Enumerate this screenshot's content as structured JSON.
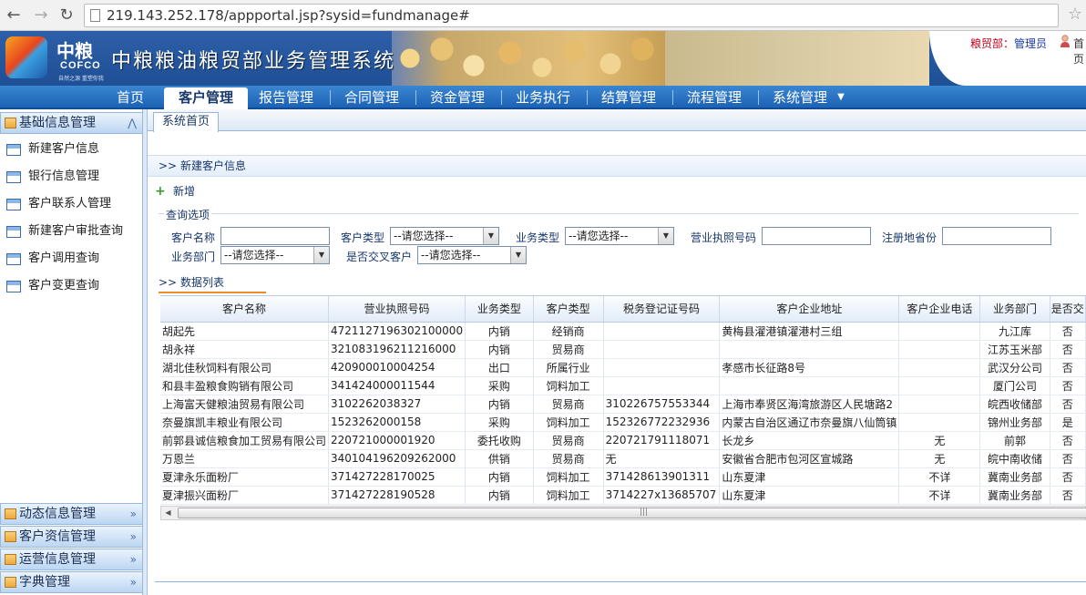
{
  "browser": {
    "url": "219.143.252.178/appportal.jsp?sysid=fundmanage#"
  },
  "header": {
    "logo_cn": "中粮",
    "logo_en": "COFCO",
    "logo_slogan": "自然之源 重塑你我",
    "title": "中粮粮油粮贸部业务管理系统",
    "dept_label": "粮贸部：",
    "user_name": "管理员",
    "home_label": "首页"
  },
  "nav": {
    "tabs": [
      "首页",
      "客户管理",
      "报告管理",
      "合同管理",
      "资金管理",
      "业务执行",
      "结算管理",
      "流程管理",
      "系统管理"
    ],
    "active": "客户管理"
  },
  "sidebar": {
    "top_group": "基础信息管理",
    "items": [
      "新建客户信息",
      "银行信息管理",
      "客户联系人管理",
      "新建客户审批查询",
      "客户调用查询",
      "客户变更查询"
    ],
    "bottom_groups": [
      "动态信息管理",
      "客户资信管理",
      "运营信息管理",
      "字典管理"
    ]
  },
  "content": {
    "tab": "系统首页",
    "breadcrumb": "新建客户信息",
    "add_button": "新增",
    "query_legend": "查询选项",
    "query": {
      "customer_name_label": "客户名称",
      "customer_type_label": "客户类型",
      "business_type_label": "业务类型",
      "license_label": "营业执照号码",
      "province_label": "注册地省份",
      "department_label": "业务部门",
      "cross_label": "是否交叉客户",
      "select_placeholder": "--请您选择--"
    },
    "list_title": "数据列表"
  },
  "table": {
    "columns": [
      "客户名称",
      "营业执照号码",
      "业务类型",
      "客户类型",
      "税务登记证号码",
      "客户企业地址",
      "客户企业电话",
      "业务部门",
      "是否交"
    ],
    "rows": [
      [
        "胡起先",
        "4721127196302100000",
        "内销",
        "经销商",
        "",
        "黄梅县濯港镇濯港村三组",
        "",
        "九江库",
        "否"
      ],
      [
        "胡永祥",
        "321083196211216000",
        "内销",
        "贸易商",
        "",
        "",
        "",
        "江苏玉米部",
        "否"
      ],
      [
        "湖北佳秋饲料有限公司",
        "420900010004254",
        "出口",
        "所属行业",
        "",
        "孝感市长征路8号",
        "",
        "武汉分公司",
        "否"
      ],
      [
        "和县丰盈粮食购销有限公司",
        "341424000011544",
        "采购",
        "饲料加工",
        "",
        "",
        "",
        "厦门公司",
        "否"
      ],
      [
        "上海富天健粮油贸易有限公司",
        "3102262038327",
        "内销",
        "贸易商",
        "310226757553344",
        "上海市奉贤区海湾旅游区人民塘路2",
        "",
        "皖西收储部",
        "否"
      ],
      [
        "奈曼旗凯丰粮业有限公司",
        "1523262000158",
        "采购",
        "饲料加工",
        "152326772232936",
        "内蒙古自治区通辽市奈曼旗八仙筒镇",
        "",
        "锦州业务部",
        "是"
      ],
      [
        "前郭县诚信粮食加工贸易有限公司",
        "2207210000019​20",
        "委托收购",
        "贸易商",
        "220721791118071",
        "长龙乡",
        "无",
        "前郭",
        "否"
      ],
      [
        "万恩兰",
        "340104196209262000",
        "供销",
        "贸易商",
        "无",
        "安徽省合肥市包河区宣城路",
        "无",
        "皖中南收储",
        "否"
      ],
      [
        "夏津永乐面粉厂",
        "371427228170025",
        "内销",
        "饲料加工",
        "371428613901311",
        "山东夏津",
        "不详",
        "冀南业务部",
        "否"
      ],
      [
        "夏津振兴面粉厂",
        "371427228190528",
        "内销",
        "饲料加工",
        "3714227x13685707",
        "山东夏津",
        "不详",
        "冀南业务部",
        "否"
      ]
    ]
  },
  "colors": {
    "nav_blue": "#1d62b4",
    "accent_orange": "#f08a24",
    "label_blue": "#17376b"
  }
}
